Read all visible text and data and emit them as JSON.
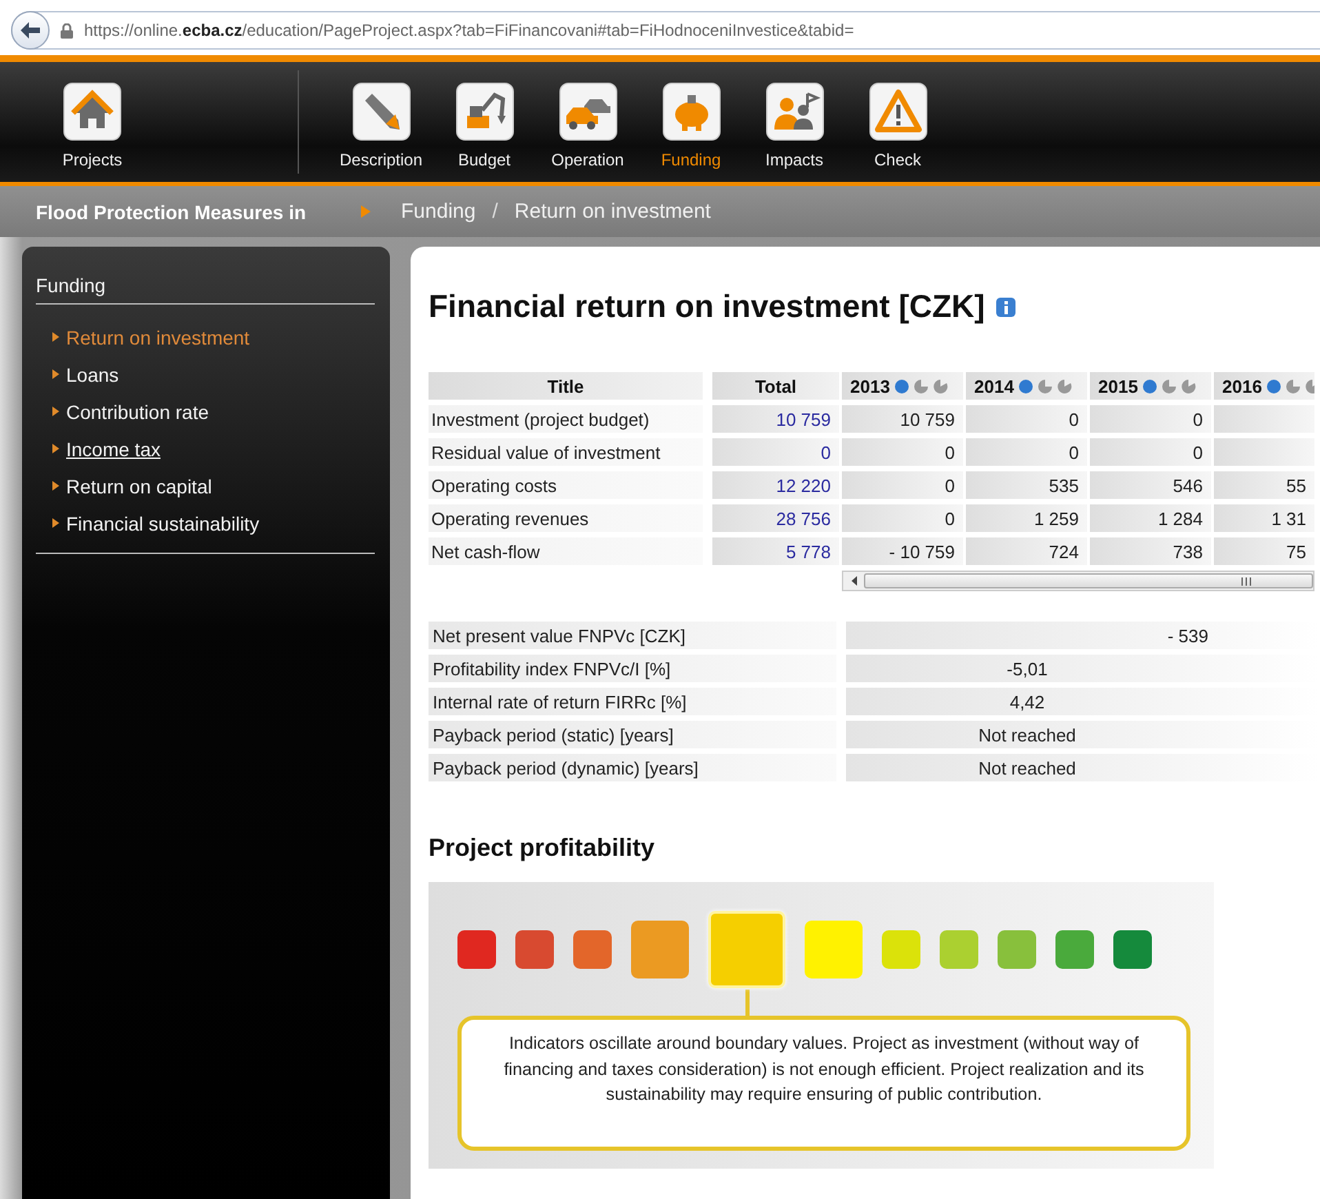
{
  "browser": {
    "url": "https://online.**ecba.cz**/education/PageProject.aspx?tab=FiFinancovani#tab=FiHodnoceniInvestice&tabid="
  },
  "nav": [
    {
      "label": "Projects",
      "kind": "home",
      "selected": false
    },
    {
      "label": "Description",
      "kind": "pencil",
      "selected": false
    },
    {
      "label": "Budget",
      "kind": "excavator",
      "selected": false
    },
    {
      "label": "Operation",
      "kind": "cars",
      "selected": false
    },
    {
      "label": "Funding",
      "kind": "piggy",
      "selected": true
    },
    {
      "label": "Impacts",
      "kind": "people",
      "selected": false
    },
    {
      "label": "Check",
      "kind": "warning",
      "selected": false
    }
  ],
  "breadcrumb": {
    "project": "Flood Protection Measures in",
    "path": [
      "Funding",
      "Return on investment"
    ],
    "separator": "/"
  },
  "sidebar": {
    "heading": "Funding",
    "items": [
      {
        "label": "Return on investment",
        "selected": true,
        "underlined": false
      },
      {
        "label": "Loans",
        "selected": false,
        "underlined": false
      },
      {
        "label": "Contribution rate",
        "selected": false,
        "underlined": false
      },
      {
        "label": "Income tax",
        "selected": false,
        "underlined": true
      },
      {
        "label": "Return on capital",
        "selected": false,
        "underlined": false
      },
      {
        "label": "Financial sustainability",
        "selected": false,
        "underlined": false
      }
    ]
  },
  "page_title": "Financial return on investment [CZK]",
  "cashflow_table": {
    "columns": [
      "Title",
      "Total",
      "2013",
      "2014",
      "2015",
      "2016"
    ],
    "rows": [
      {
        "title": "Investment (project budget)",
        "total": "10 759",
        "years": [
          "10 759",
          "0",
          "0"
        ]
      },
      {
        "title": "Residual value of investment",
        "total": "0",
        "years": [
          "0",
          "0",
          "0"
        ]
      },
      {
        "title": "Operating costs",
        "total": "12 220",
        "years": [
          "0",
          "535",
          "546",
          "55"
        ]
      },
      {
        "title": "Operating revenues",
        "total": "28 756",
        "years": [
          "0",
          "1 259",
          "1 284",
          "1 31"
        ]
      },
      {
        "title": "Net cash-flow",
        "total": "5 778",
        "years": [
          "- 10 759",
          "724",
          "738",
          "75"
        ]
      }
    ]
  },
  "indicators": [
    {
      "label": "Net present value FNPVc [CZK]",
      "value": "- 539",
      "kind": "amount"
    },
    {
      "label": "Profitability index FNPVc/I [%]",
      "value": "-5,01",
      "kind": "ratio"
    },
    {
      "label": "Internal rate of return FIRRc [%]",
      "value": "4,42",
      "kind": "ratio"
    },
    {
      "label": "Payback period (static) [years]",
      "value": "Not reached",
      "kind": "ratio"
    },
    {
      "label": "Payback period (dynamic) [years]",
      "value": "Not reached",
      "kind": "ratio"
    }
  ],
  "profitability": {
    "title": "Project profitability",
    "levels": [
      {
        "color": "#e02820",
        "selected": false
      },
      {
        "color": "#d84a30",
        "selected": false
      },
      {
        "color": "#e3662a",
        "selected": false
      },
      {
        "color": "#eb9a22",
        "selected": false
      },
      {
        "color": "#f5cf00",
        "selected": true
      },
      {
        "color": "#fff200",
        "selected": false
      },
      {
        "color": "#dbe20a",
        "selected": false
      },
      {
        "color": "#abd030",
        "selected": false
      },
      {
        "color": "#88c03c",
        "selected": false
      },
      {
        "color": "#4aaa3c",
        "selected": false
      },
      {
        "color": "#158a3c",
        "selected": false
      }
    ],
    "message": "Indicators oscillate around boundary values. Project as investment (without way of financing and taxes consideration) is not enough efficient. Project realization and its sustainability may require ensuring of public contribution."
  }
}
